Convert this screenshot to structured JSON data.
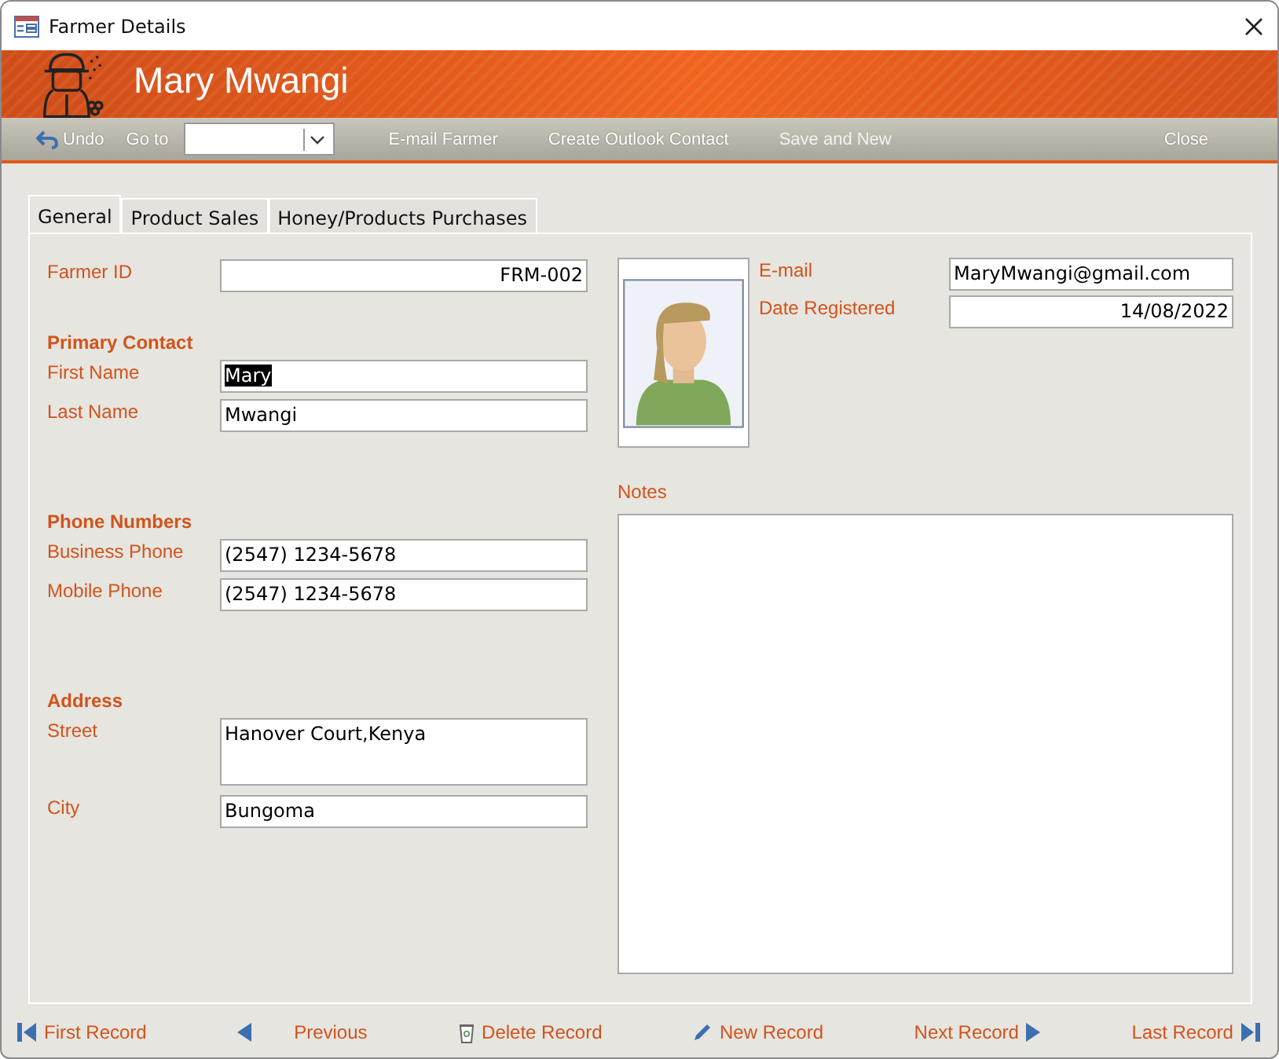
{
  "window": {
    "title": "Farmer Details"
  },
  "header": {
    "name": "Mary Mwangi"
  },
  "toolbar": [
    {
      "kind": "undo",
      "label": "Undo",
      "disabled": false
    },
    {
      "kind": "goto",
      "label": "Go to"
    },
    {
      "kind": "button",
      "label": "E-mail Farmer",
      "disabled": false
    },
    {
      "kind": "button",
      "label": "Create Outlook Contact",
      "disabled": false
    },
    {
      "kind": "button",
      "label": "Save and New",
      "disabled": true
    },
    {
      "kind": "close",
      "label": "Close",
      "disabled": false
    }
  ],
  "tabs": [
    {
      "label": "General",
      "selected": true
    },
    {
      "label": "Product Sales",
      "selected": false
    },
    {
      "label": "Honey/Products Purchases",
      "selected": false
    }
  ],
  "sections": [
    {
      "fields": [
        {
          "label": "Farmer ID",
          "value": "FRM-002",
          "right_aligned": true
        }
      ]
    },
    {
      "heading": "Primary Contact",
      "fields": [
        {
          "label": "First Name",
          "value": "Mary",
          "text_selected": true
        },
        {
          "label": "Last Name",
          "value": "Mwangi",
          "text_selected": false
        }
      ]
    },
    {
      "heading": "Phone Numbers",
      "fields": [
        {
          "label": "Business Phone",
          "value": "(2547) 1234-5678"
        },
        {
          "label": "Mobile Phone",
          "value": "(2547) 1234-5678"
        }
      ]
    },
    {
      "heading": "Address",
      "fields": [
        {
          "label": "Street",
          "value": "Hanover Court,Kenya",
          "multiline": true
        },
        {
          "label": "City",
          "value": "Bungoma"
        }
      ]
    }
  ],
  "contact_fields": [
    {
      "label": "E-mail",
      "value": "MaryMwangi@gmail.com",
      "right_aligned": false
    },
    {
      "label": "Date Registered",
      "value": "14/08/2022",
      "right_aligned": true
    }
  ],
  "notes": {
    "label": "Notes"
  },
  "navigation": [
    {
      "kind": "first",
      "label": "First Record"
    },
    {
      "kind": "previous",
      "label": "Previous"
    },
    {
      "kind": "delete",
      "label": "Delete Record"
    },
    {
      "kind": "new",
      "label": "New Record"
    },
    {
      "kind": "next",
      "label": "Next Record"
    },
    {
      "kind": "last",
      "label": "Last Record"
    }
  ]
}
